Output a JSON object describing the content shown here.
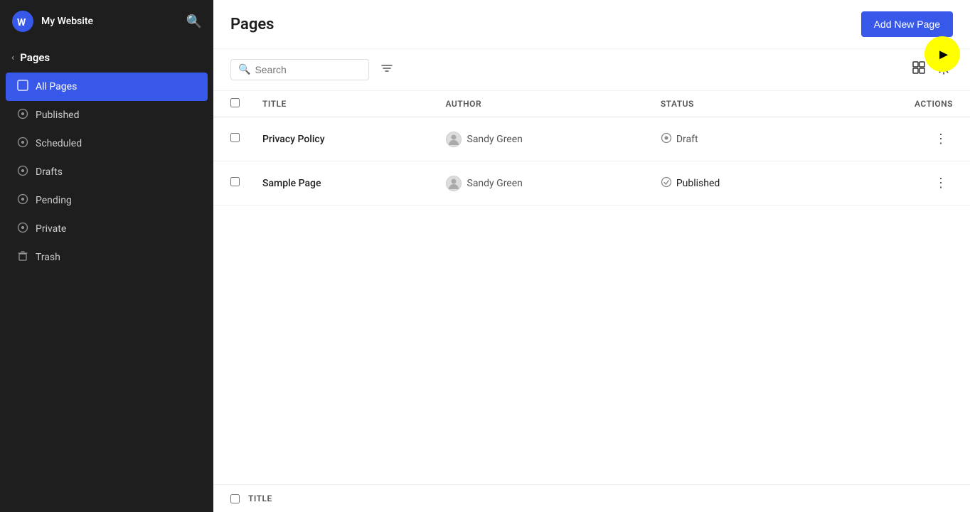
{
  "sidebar": {
    "site_name": "My Website",
    "search_label": "Search",
    "section_title": "Pages",
    "nav_items": [
      {
        "id": "all-pages",
        "label": "All Pages",
        "icon": "□",
        "active": true
      },
      {
        "id": "published",
        "label": "Published",
        "icon": "○"
      },
      {
        "id": "scheduled",
        "label": "Scheduled",
        "icon": "○"
      },
      {
        "id": "drafts",
        "label": "Drafts",
        "icon": "○"
      },
      {
        "id": "pending",
        "label": "Pending",
        "icon": "○"
      },
      {
        "id": "private",
        "label": "Private",
        "icon": "○"
      },
      {
        "id": "trash",
        "label": "Trash",
        "icon": "🗑"
      }
    ]
  },
  "main": {
    "title": "Pages",
    "add_new_label": "Add New Page",
    "toolbar": {
      "search_placeholder": "Search",
      "filter_label": "Filter",
      "view_label": "View",
      "settings_label": "Settings",
      "actions_col": "ACTIONS"
    },
    "table": {
      "columns": [
        "TITLE",
        "AUTHOR",
        "STATUS",
        "ACTIONS"
      ],
      "rows": [
        {
          "title": "Privacy Policy",
          "author": "Sandy Green",
          "status": "Draft",
          "status_type": "draft"
        },
        {
          "title": "Sample Page",
          "author": "Sandy Green",
          "status": "Published",
          "status_type": "published"
        }
      ]
    }
  }
}
